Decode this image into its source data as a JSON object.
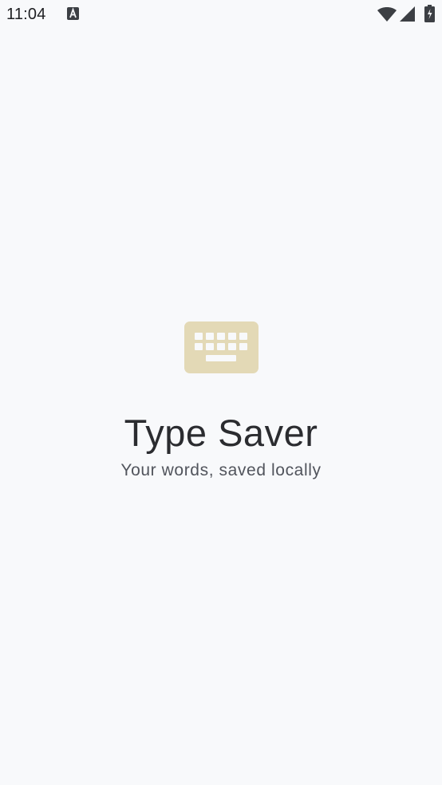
{
  "status_bar": {
    "time": "11:04",
    "icons": [
      "a-notification-icon",
      "wifi-icon",
      "cell-signal-icon",
      "battery-icon"
    ]
  },
  "splash": {
    "icon": "keyboard-icon",
    "title": "Type Saver",
    "tagline": "Your words, saved locally"
  },
  "colors": {
    "background": "#f8f9fb",
    "keyboard_icon": "#e3d9b6",
    "title_text": "#2b2c30",
    "tagline_text": "#51545c"
  }
}
